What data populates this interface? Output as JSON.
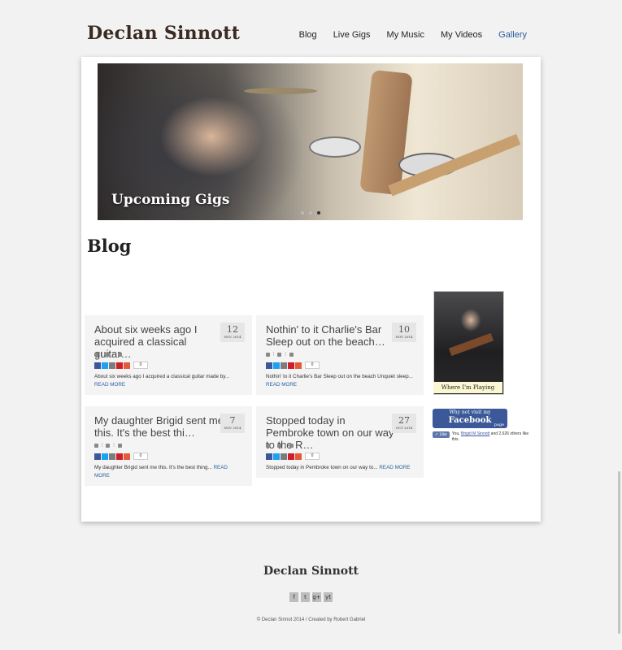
{
  "header": {
    "logo": "Declan Sinnott",
    "nav": [
      {
        "label": "Blog",
        "active": false
      },
      {
        "label": "Live Gigs",
        "active": false
      },
      {
        "label": "My Music",
        "active": false
      },
      {
        "label": "My Videos",
        "active": false
      },
      {
        "label": "Gallery",
        "active": true
      }
    ]
  },
  "hero": {
    "caption": "Upcoming Gigs",
    "slides": 3,
    "active_slide": 3
  },
  "section_title": "Blog",
  "posts": [
    {
      "title": "About six weeks ago I acquired a classical guitar…",
      "day": "12",
      "month": "NOV 2014",
      "share_count": "0",
      "excerpt": "About six weeks ago I acquired a classical guitar made by...",
      "read_more": "READ MORE"
    },
    {
      "title": "Nothin' to it Charlie's Bar Sleep out on the beach…",
      "day": "10",
      "month": "NOV 2014",
      "share_count": "0",
      "excerpt": "Nothin' to it Charlie's Bar Sleep out on the beach Unquiet sleep...",
      "read_more": "READ MORE"
    },
    {
      "title": "My daughter Brigid sent me this. It's the best thi…",
      "day": "7",
      "month": "NOV 2014",
      "share_count": "0",
      "excerpt": "My daughter Brigid sent me this. It's the best thing...",
      "read_more": "READ MORE"
    },
    {
      "title": "Stopped today in Pembroke town on our way to the R…",
      "day": "27",
      "month": "OCT 2014",
      "share_count": "0",
      "excerpt": "Stopped today in Pembroke town on our way to...",
      "read_more": "READ MORE"
    }
  ],
  "sidebar": {
    "photo_caption": "Where I'm Playing",
    "facebook": {
      "line1": "Why not visit my",
      "line2": "Facebook",
      "line3": "page"
    },
    "like_button": "Like",
    "like_text_prefix": "You, ",
    "like_name": "Brigid M Sinnott",
    "like_text_suffix": " and 2,626 others like this."
  },
  "footer": {
    "logo": "Declan Sinnott",
    "social": [
      "f",
      "t",
      "g+",
      "yt"
    ],
    "copyright": "© Declan Sinnot 2014 / Created by Robert Gabriel"
  },
  "colors": {
    "link": "#2b5f9e",
    "facebook": "#3b5998",
    "card_bg": "#f4f4f4"
  }
}
